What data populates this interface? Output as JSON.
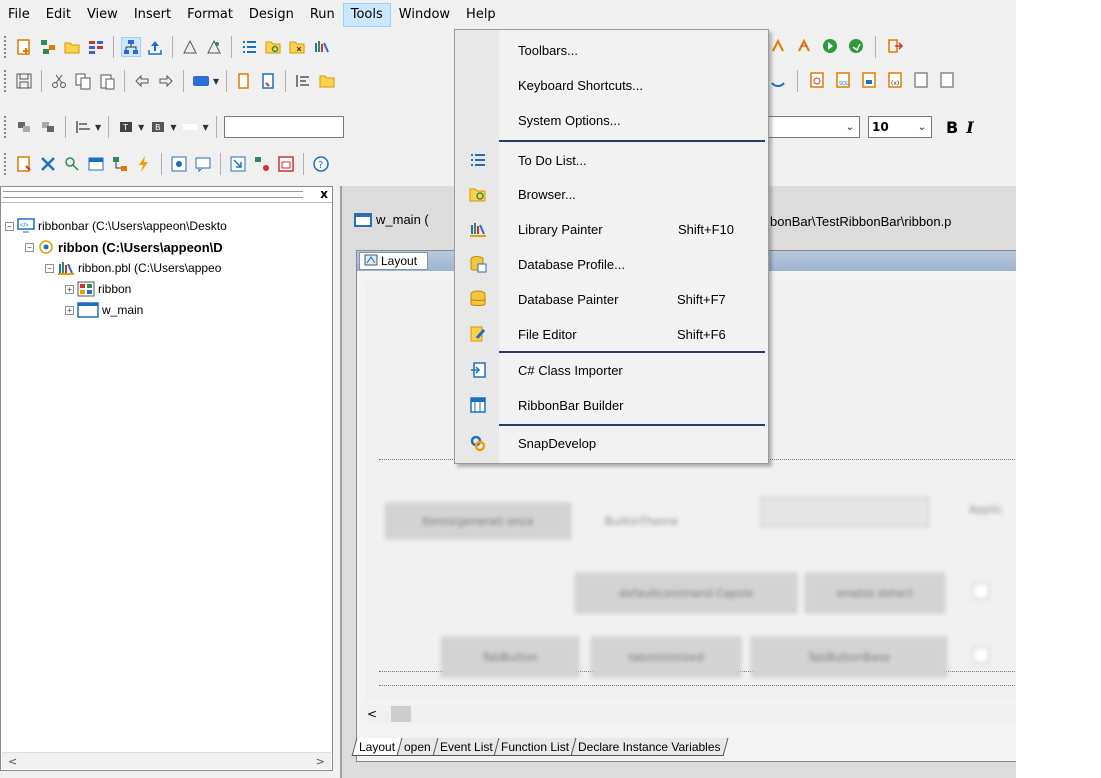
{
  "menubar": {
    "items": [
      "File",
      "Edit",
      "View",
      "Insert",
      "Format",
      "Design",
      "Run",
      "Tools",
      "Window",
      "Help"
    ],
    "active_index": 7
  },
  "toolbar": {
    "font_size": "10",
    "bold_label": "B",
    "italic_label": "I"
  },
  "tree": {
    "workspace": "ribbonbar (C:\\Users\\appeon\\Deskto",
    "target": "ribbon (C:\\Users\\appeon\\D",
    "library": "ribbon.pbl (C:\\Users\\appeo",
    "objects": [
      "ribbon",
      "w_main"
    ]
  },
  "editor": {
    "doc_title": "w_main (",
    "doc_path": "bonBar\\TestRibbonBar\\ribbon.p",
    "layout_tab": "Layout",
    "bottom_tabs": [
      "Layout",
      "open",
      "Event List",
      "Function List",
      "Declare Instance Variables"
    ],
    "blurred": {
      "btn1": "Items(general) once",
      "label1": "BuiltinTheme",
      "label2": "Applic",
      "btn2": "defaultcommand Capsle",
      "btn3": "enable detect",
      "btn4": "TabButton",
      "btn5": "tabminimized",
      "btn6": "TabButtonBase"
    }
  },
  "tools_menu": {
    "items": [
      {
        "label": "Toolbars...",
        "shortcut": "",
        "icon": ""
      },
      {
        "label": "Keyboard Shortcuts...",
        "shortcut": "",
        "icon": ""
      },
      {
        "label": "System Options...",
        "shortcut": "",
        "icon": ""
      },
      {
        "label": "To Do List...",
        "shortcut": "",
        "icon": "todo-list-icon"
      },
      {
        "label": "Browser...",
        "shortcut": "",
        "icon": "browser-icon"
      },
      {
        "label": "Library Painter",
        "shortcut": "Shift+F10",
        "icon": "library-painter-icon"
      },
      {
        "label": "Database Profile...",
        "shortcut": "",
        "icon": "database-profile-icon"
      },
      {
        "label": "Database Painter",
        "shortcut": "Shift+F7",
        "icon": "database-painter-icon"
      },
      {
        "label": "File Editor",
        "shortcut": "Shift+F6",
        "icon": "file-editor-icon"
      },
      {
        "label": "C# Class Importer",
        "shortcut": "",
        "icon": "class-importer-icon"
      },
      {
        "label": "RibbonBar Builder",
        "shortcut": "",
        "icon": "ribbonbar-builder-icon"
      },
      {
        "label": "SnapDevelop",
        "shortcut": "",
        "icon": "snapdevelop-icon"
      }
    ]
  },
  "colors": {
    "menu_active_bg": "#cce8ff",
    "menu_separator": "#2b3a6b",
    "layout_bar": "#b9c8de"
  }
}
